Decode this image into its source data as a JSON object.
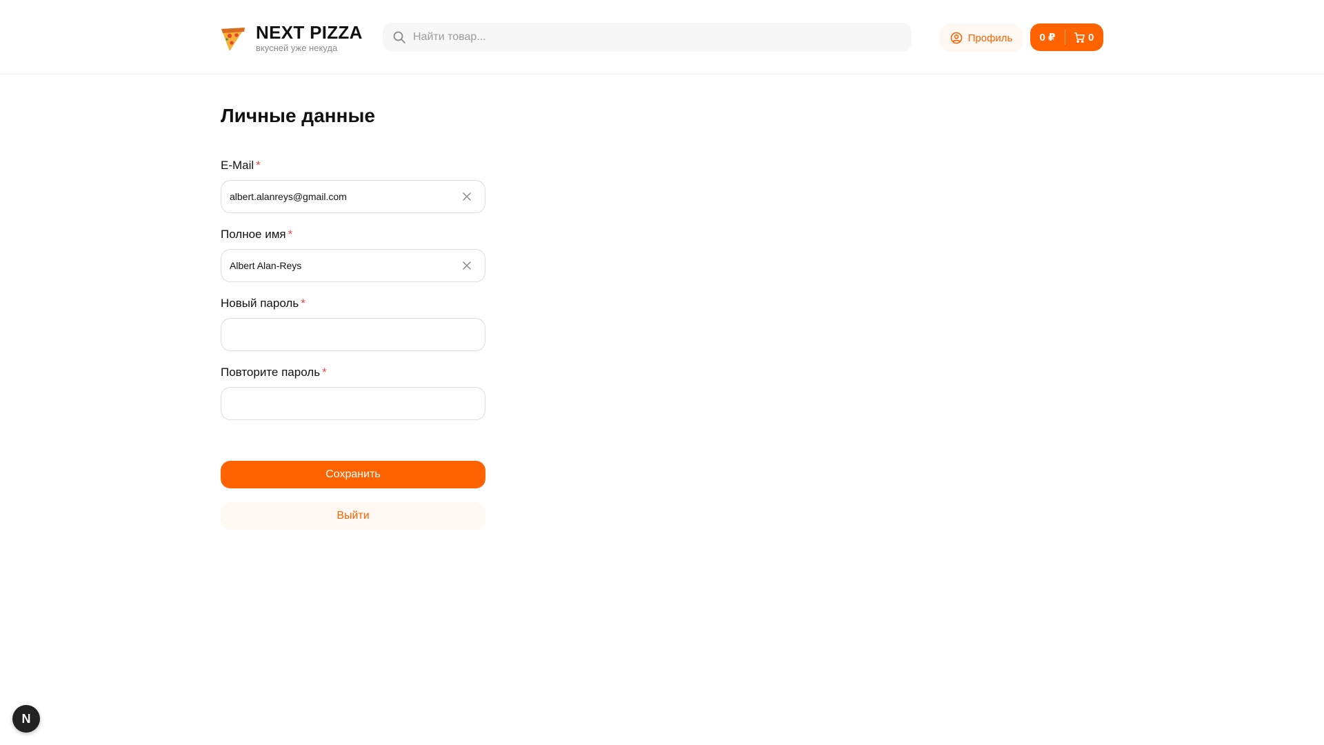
{
  "header": {
    "logo_title": "NEXT PIZZA",
    "logo_subtitle": "вкусней уже некуда",
    "logo_icon": "pizza-slice-icon",
    "search_placeholder": "Найти товар...",
    "profile_label": "Профиль",
    "cart_sum": "0 ₽",
    "cart_count": "0"
  },
  "page": {
    "title": "Личные данные"
  },
  "form": {
    "fields": [
      {
        "label": "E-Mail",
        "required_mark": "*",
        "value": "albert.alanreys@gmail.com",
        "type": "text",
        "clearable": true
      },
      {
        "label": "Полное имя",
        "required_mark": "*",
        "value": "Albert Alan-Reys",
        "type": "text",
        "clearable": true
      },
      {
        "label": "Новый пароль",
        "required_mark": "*",
        "value": "",
        "type": "password",
        "clearable": false
      },
      {
        "label": "Повторите пароль",
        "required_mark": "*",
        "value": "",
        "type": "password",
        "clearable": false
      }
    ],
    "save_label": "Сохранить",
    "logout_label": "Выйти"
  },
  "dev_badge": {
    "label": "N"
  },
  "colors": {
    "accent": "#ff6300",
    "accent_soft": "#fff7f2",
    "required": "#e5484d",
    "border": "#dddddd"
  }
}
